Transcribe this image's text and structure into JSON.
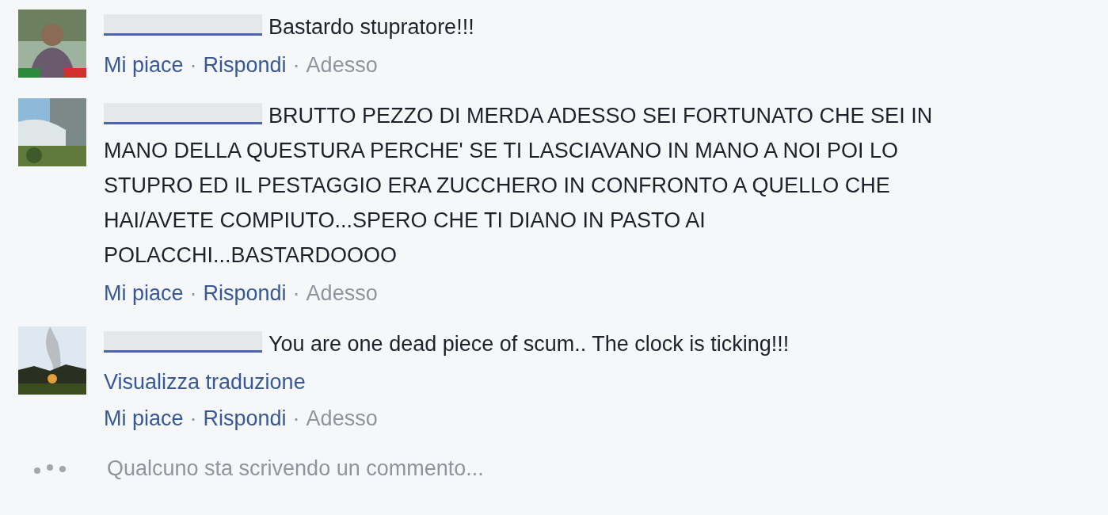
{
  "comments": [
    {
      "author_redacted": true,
      "text": "Bastardo stupratore!!!",
      "meta": [
        {
          "kind": "link",
          "text": "Mi piace"
        },
        {
          "kind": "dot",
          "text": "·"
        },
        {
          "kind": "link",
          "text": "Rispondi"
        },
        {
          "kind": "dot",
          "text": "·"
        },
        {
          "kind": "time",
          "text": "Adesso"
        }
      ]
    },
    {
      "author_redacted": true,
      "text": "BRUTTO PEZZO DI MERDA ADESSO SEI FORTUNATO CHE SEI IN MANO DELLA QUESTURA PERCHE' SE TI LASCIAVANO IN MANO A NOI POI LO STUPRO ED IL PESTAGGIO ERA ZUCCHERO IN CONFRONTO A QUELLO CHE HAI/AVETE COMPIUTO...SPERO CHE TI DIANO IN PASTO AI POLACCHI...BASTARDOOOO",
      "meta": [
        {
          "kind": "link",
          "text": "Mi piace"
        },
        {
          "kind": "dot",
          "text": "·"
        },
        {
          "kind": "link",
          "text": "Rispondi"
        },
        {
          "kind": "dot",
          "text": "·"
        },
        {
          "kind": "time",
          "text": "Adesso"
        }
      ]
    },
    {
      "author_redacted": true,
      "text": "You are one dead piece of scum.. The clock is ticking!!!",
      "translate_link": "Visualizza traduzione",
      "meta": [
        {
          "kind": "link",
          "text": "Mi piace"
        },
        {
          "kind": "dot",
          "text": "·"
        },
        {
          "kind": "link",
          "text": "Rispondi"
        },
        {
          "kind": "dot",
          "text": "·"
        },
        {
          "kind": "time",
          "text": "Adesso"
        }
      ]
    }
  ],
  "typing": {
    "text": "Qualcuno sta scrivendo un commento..."
  }
}
